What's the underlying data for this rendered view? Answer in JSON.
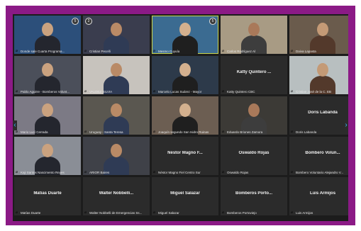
{
  "meeting": {
    "tiles": [
      {
        "name": "Donde sale Cuarta Programa...",
        "video": true,
        "bg": "#2c4f7a",
        "badge": "5"
      },
      {
        "name": "Cristian Pecelli",
        "video": true,
        "bg": "#3a3d4e",
        "badge": "2"
      },
      {
        "name": "Mesmo Cuyuía",
        "video": true,
        "bg": "#3b6b91",
        "badge": "5",
        "active": true
      },
      {
        "name": "Carlos Rodríguez Al",
        "video": true,
        "bg": "#a89b84"
      },
      {
        "name": "Daiva Lapasta",
        "video": true,
        "bg": "#6a5b4c"
      },
      {
        "name": "Pablo Aguirre - Bomberos Volunt...",
        "video": true,
        "bg": "#4b4f5a"
      },
      {
        "name": "VALDEZ SILVIA",
        "video": true,
        "bg": "#c7c3bd"
      },
      {
        "name": "Marcelo Lucas Suárez - Mayor",
        "video": true,
        "bg": "#2d3a4a"
      },
      {
        "name": "Katty Quintero ...",
        "video": false,
        "footer": "Katty Quintero CBC"
      },
      {
        "name": "Cristian José de la C. EB",
        "video": true,
        "bg": "#b8bfc0"
      },
      {
        "name": "Mario Lucí Cerrada",
        "video": true,
        "bg": "#7c7a85"
      },
      {
        "name": "Uruguay - Santa Teresa",
        "video": true,
        "bg": "#5a5750"
      },
      {
        "name": "Joaquín segundo San Isidro Ruinas",
        "video": true,
        "bg": "#6c5e52"
      },
      {
        "name": "Eduardo Briones Zamora",
        "video": true,
        "bg": "#3c3a36"
      },
      {
        "name": "Doris Labanda",
        "video": false,
        "footer": "Doris Labanda"
      },
      {
        "name": "Kaji Santos Nascimento Reyes",
        "video": true,
        "bg": "#8a8e96"
      },
      {
        "name": "ARIOR Baires",
        "video": true,
        "bg": "#3f4148"
      },
      {
        "name": "Néstor Magno F...",
        "video": false,
        "footer": "Néstor Magno Fiel Centro Sur"
      },
      {
        "name": "Oswaldo Rojas",
        "video": false,
        "footer": "Oswaldo Rojas"
      },
      {
        "name": "Bombero Volun...",
        "video": false,
        "footer": "Bombero Voluntario Alejandro V..."
      },
      {
        "name": "Matias Duarte",
        "video": false,
        "footer": "Matías Duarte"
      },
      {
        "name": "Walter Nobbelli...",
        "video": false,
        "footer": "Walter Nobbelli de Emergencias Ss..."
      },
      {
        "name": "Miguel Salazar",
        "video": false,
        "footer": "Miguel Salazar"
      },
      {
        "name": "Bomberos Porto...",
        "video": false,
        "footer": "Bomberos Portoviejo"
      },
      {
        "name": "Luis Armijos",
        "video": false,
        "footer": "Luis Armijos"
      }
    ]
  },
  "colors": {
    "frame": "#8b1a86",
    "background": "#1c1c1c",
    "tile": "#2b2b2b",
    "mic_muted": "#e23b3b",
    "active_border": "#c9d44a"
  },
  "icons": {
    "mic": "muted-mic-icon",
    "prev": "chevron-left-icon",
    "next": "chevron-right-icon"
  }
}
